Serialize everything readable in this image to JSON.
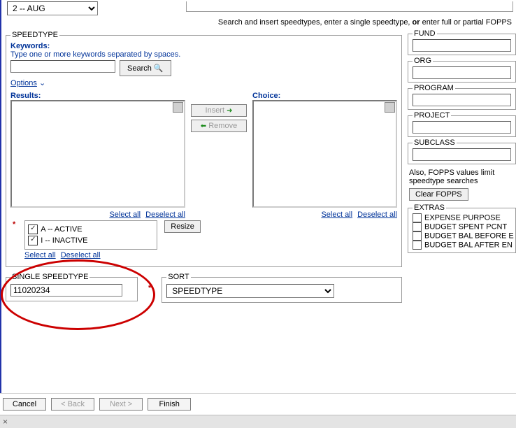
{
  "top": {
    "month_select": "2 -- AUG"
  },
  "instruction_prefix": "Search and insert speedtypes, enter a single speedtype, ",
  "instruction_bold": "or",
  "instruction_suffix": " enter full or partial FOPPS",
  "speedtype": {
    "legend": "SPEEDTYPE",
    "keywords_label": "Keywords:",
    "keywords_hint": "Type one or more keywords separated by spaces.",
    "search_btn": "Search",
    "options_link": "Options",
    "results_label": "Results:",
    "insert_btn": "Insert",
    "remove_btn": "Remove",
    "choice_label": "Choice:",
    "select_all": "Select all",
    "deselect_all": "Deselect all",
    "active_label": "A -- ACTIVE",
    "inactive_label": "I -- INACTIVE",
    "resize_btn": "Resize"
  },
  "single": {
    "legend": "SINGLE SPEEDTYPE",
    "value": "11020234"
  },
  "sort": {
    "legend": "SORT",
    "value": "SPEEDTYPE"
  },
  "fopps": {
    "fund": "FUND",
    "org": "ORG",
    "program": "PROGRAM",
    "project": "PROJECT",
    "subclass": "SUBCLASS",
    "note": "Also, FOPPS values limit speedtype searches",
    "clear_btn": "Clear FOPPS",
    "extras_legend": "EXTRAS",
    "extras": [
      "EXPENSE PURPOSE",
      "BUDGET SPENT PCNT",
      "BUDGET BAL BEFORE E",
      "BUDGET BAL AFTER EN"
    ]
  },
  "wizard": {
    "cancel": "Cancel",
    "back": "< Back",
    "next": "Next >",
    "finish": "Finish"
  },
  "close_glyph": "×"
}
